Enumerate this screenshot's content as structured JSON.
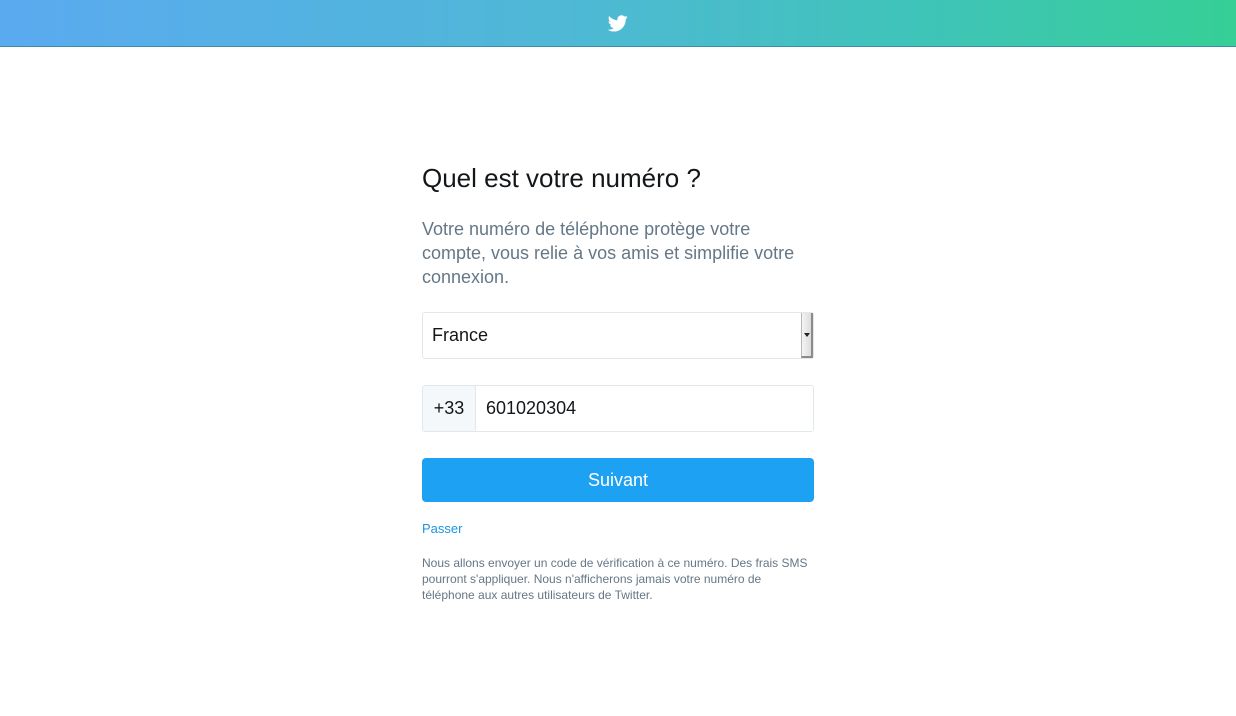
{
  "header": {
    "logo_icon": "twitter-bird-icon",
    "gradient_colors": [
      "#5aaaf0",
      "#36cf96"
    ]
  },
  "main": {
    "title": "Quel est votre numéro ?",
    "subtitle": "Votre numéro de téléphone protège votre compte, vous relie à vos amis et simplifie votre connexion.",
    "country_select": {
      "selected": "France",
      "icon": "dropdown-arrow-icon"
    },
    "phone": {
      "prefix": "+33",
      "value": "601020304"
    },
    "next_button_label": "Suivant",
    "skip_label": "Passer",
    "disclaimer": "Nous allons envoyer un code de vérification à ce numéro. Des frais SMS pourront s'appliquer. Nous n'afficherons jamais votre numéro de téléphone aux autres utilisateurs de Twitter."
  },
  "colors": {
    "accent": "#1da1f2",
    "link": "#1b95e0",
    "muted_text": "#657786"
  }
}
